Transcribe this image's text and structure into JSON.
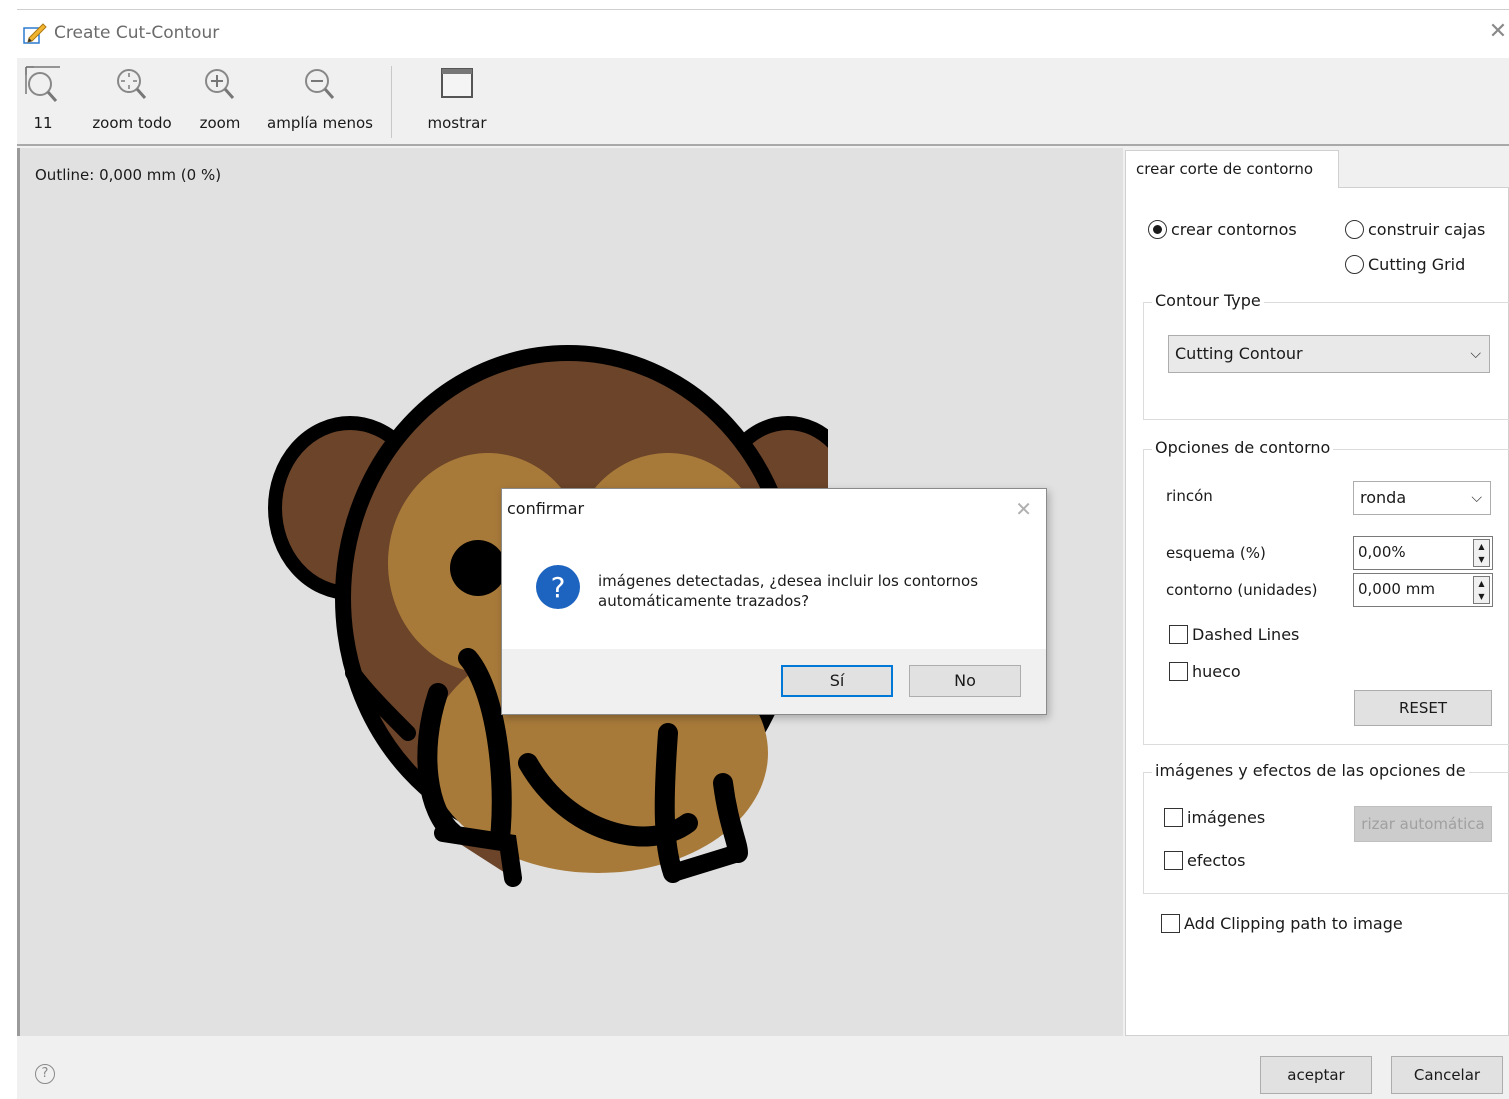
{
  "window": {
    "title": "Create Cut-Contour",
    "title_icon": "pencil-note-icon",
    "close": "✕"
  },
  "toolbar": {
    "items": [
      {
        "label": "11",
        "icon": "zoom-actual-icon"
      },
      {
        "label": "zoom todo",
        "icon": "zoom-fit-icon"
      },
      {
        "label": "zoom",
        "icon": "zoom-in-icon"
      },
      {
        "label": "amplía menos",
        "icon": "zoom-out-icon"
      },
      {
        "label": "mostrar",
        "icon": "window-icon"
      }
    ]
  },
  "canvas": {
    "outline_label": "Outline: 0,000 mm (0 %)"
  },
  "dialog": {
    "title": "confirmar",
    "close": "✕",
    "message": "imágenes detectadas, ¿desea incluir los contornos\nautomáticamente trazados?",
    "yes": "Sí",
    "no": "No",
    "icon": "question-icon"
  },
  "panel": {
    "tab": "crear corte de contorno",
    "mode": {
      "crear_contornos": "crear contornos",
      "construir_cajas": "construir cajas",
      "cutting_grid": "Cutting Grid"
    },
    "contour_type": {
      "title": "Contour Type",
      "value": "Cutting Contour"
    },
    "options": {
      "title": "Opciones de contorno",
      "rincon_label": "rincón",
      "rincon_value": "ronda",
      "esquema_label": "esquema (%)",
      "esquema_value": "0,00%",
      "contorno_label": "contorno (unidades)",
      "contorno_value": "0,000 mm",
      "dashed_lines": "Dashed Lines",
      "hueco": "hueco",
      "reset": "RESET"
    },
    "images_effects": {
      "title": "imágenes y efectos de las opciones de",
      "imagenes": "imágenes",
      "efectos": "efectos",
      "auto_button": "rizar automática"
    },
    "clipping": "Add Clipping path to image"
  },
  "footer": {
    "help": "?",
    "ok": "aceptar",
    "cancel": "Cancelar"
  }
}
